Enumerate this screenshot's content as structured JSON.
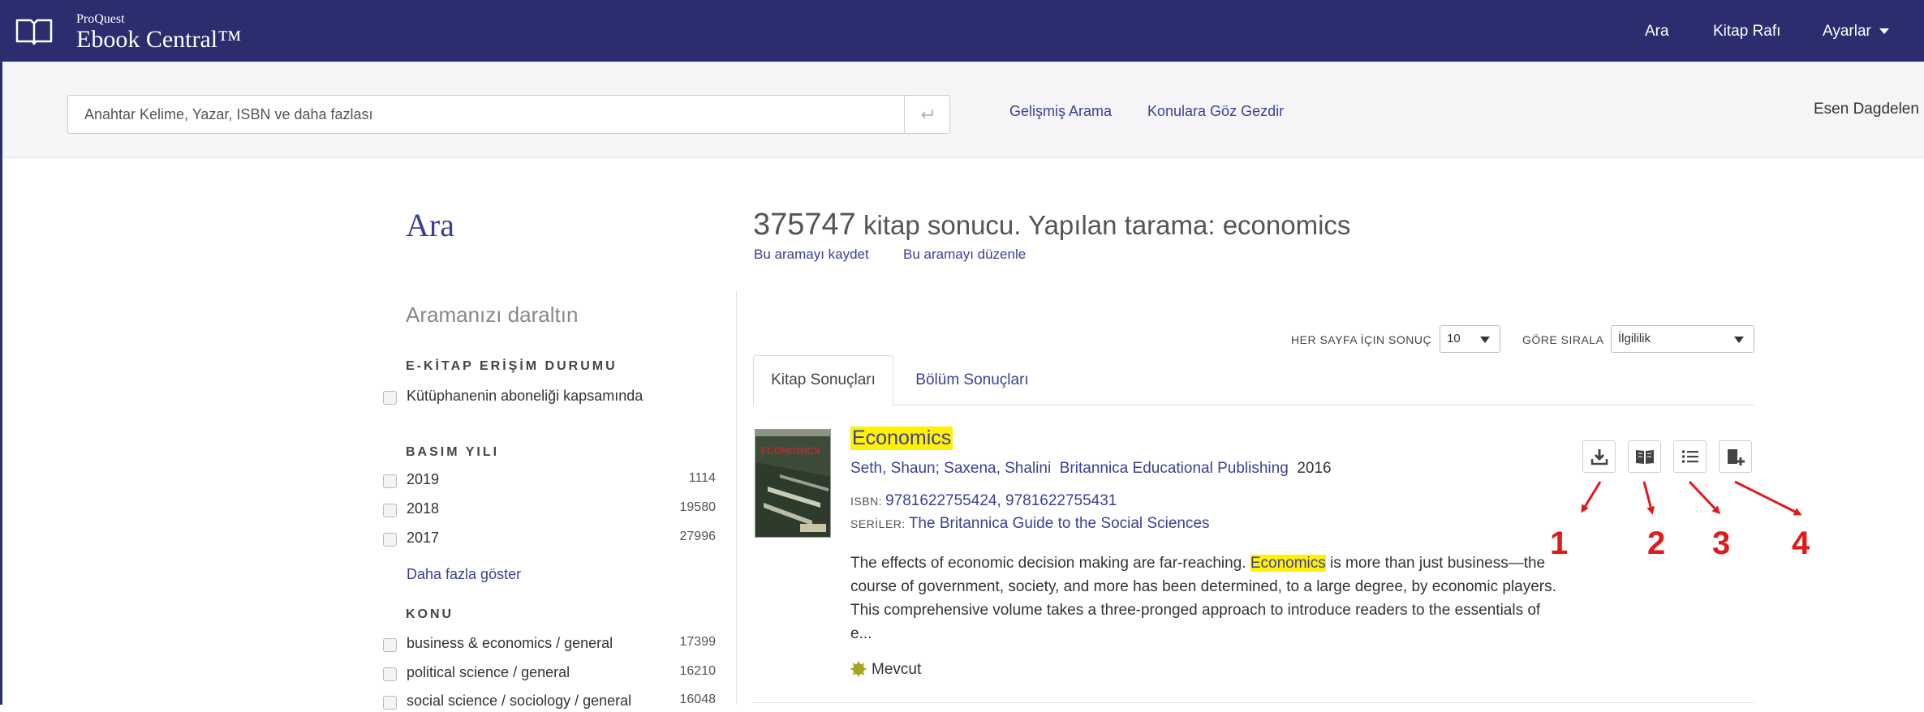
{
  "topbar": {
    "brand_small": "ProQuest",
    "brand_big": "Ebook Central™",
    "nav": {
      "search": "Ara",
      "bookshelf": "Kitap Rafı",
      "settings": "Ayarlar"
    }
  },
  "search": {
    "placeholder": "Anahtar Kelime, Yazar, ISBN ve daha fazlası",
    "advanced": "Gelişmiş Arama",
    "browse": "Konulara Göz Gezdir",
    "user": "Esen Dagdelen"
  },
  "page": {
    "title": "Ara"
  },
  "refine": {
    "title": "Aramanızı daraltın",
    "access": {
      "heading": "E-KİTAP ERİŞİM DURUMU",
      "items": [
        {
          "label": "Kütüphanenin aboneliği kapsamında"
        }
      ]
    },
    "year": {
      "heading": "BASIM YILI",
      "items": [
        {
          "label": "2019",
          "count": "1114"
        },
        {
          "label": "2018",
          "count": "19580"
        },
        {
          "label": "2017",
          "count": "27996"
        }
      ],
      "more": "Daha fazla göster"
    },
    "subject": {
      "heading": "KONU",
      "items": [
        {
          "label": "business & economics / general",
          "count": "17399"
        },
        {
          "label": "political science / general",
          "count": "16210"
        },
        {
          "label": "social science / sociology / general",
          "count": "16048"
        }
      ]
    }
  },
  "results": {
    "count": "375747",
    "count_text": "kitap sonucu. Yapılan tarama: economics",
    "save": "Bu aramayı kaydet",
    "edit": "Bu aramayı düzenle",
    "per_page_label": "HER SAYFA İÇIN SONUÇ",
    "per_page_value": "10",
    "sort_label": "GÖRE SIRALA",
    "sort_value": "İlgililik",
    "tabs": [
      "Kitap Sonuçları",
      "Bölüm Sonuçları"
    ],
    "item": {
      "cover_text": "ECONOMICS",
      "title": "Economics",
      "authors": "Seth, Shaun; Saxena, Shalini",
      "publisher": "Britannica Educational Publishing",
      "year": "2016",
      "isbn_label": "ISBN:",
      "isbn": "9781622755424, 9781622755431",
      "series_label": "SERİLER:",
      "series": "The Britannica Guide to the Social Sciences",
      "desc_before": "The effects of economic decision making are far-reaching. ",
      "desc_hl": "Economics",
      "desc_after": " is more than just business—the course of government, society, and more has been determined, to a large degree, by economic players. This comprehensive volume takes a three-pronged approach to introduce readers to the essentials of e...",
      "availability": "Mevcut"
    }
  },
  "annotations": [
    "1",
    "2",
    "3",
    "4"
  ]
}
